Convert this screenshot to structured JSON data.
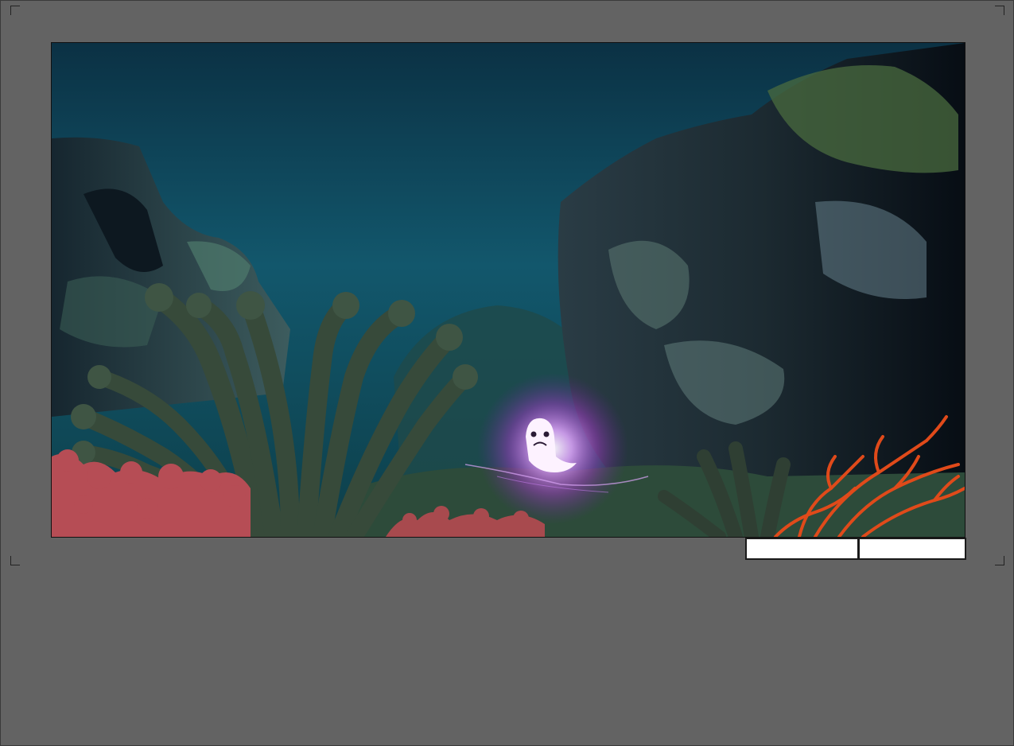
{
  "scene": {
    "water_top": "#0b3144",
    "water_mid": "#12576c",
    "water_bottom": "#0d3f4a",
    "rock_dark": "#0b1822",
    "rock_moss": "#3e5a44",
    "anemone_green": "#374a3a",
    "coral_pink": "#b64d55",
    "coral_orange": "#e04a1a",
    "creature_glow": "#b23bd8"
  },
  "controls": {
    "button_1_label": "",
    "button_2_label": ""
  }
}
